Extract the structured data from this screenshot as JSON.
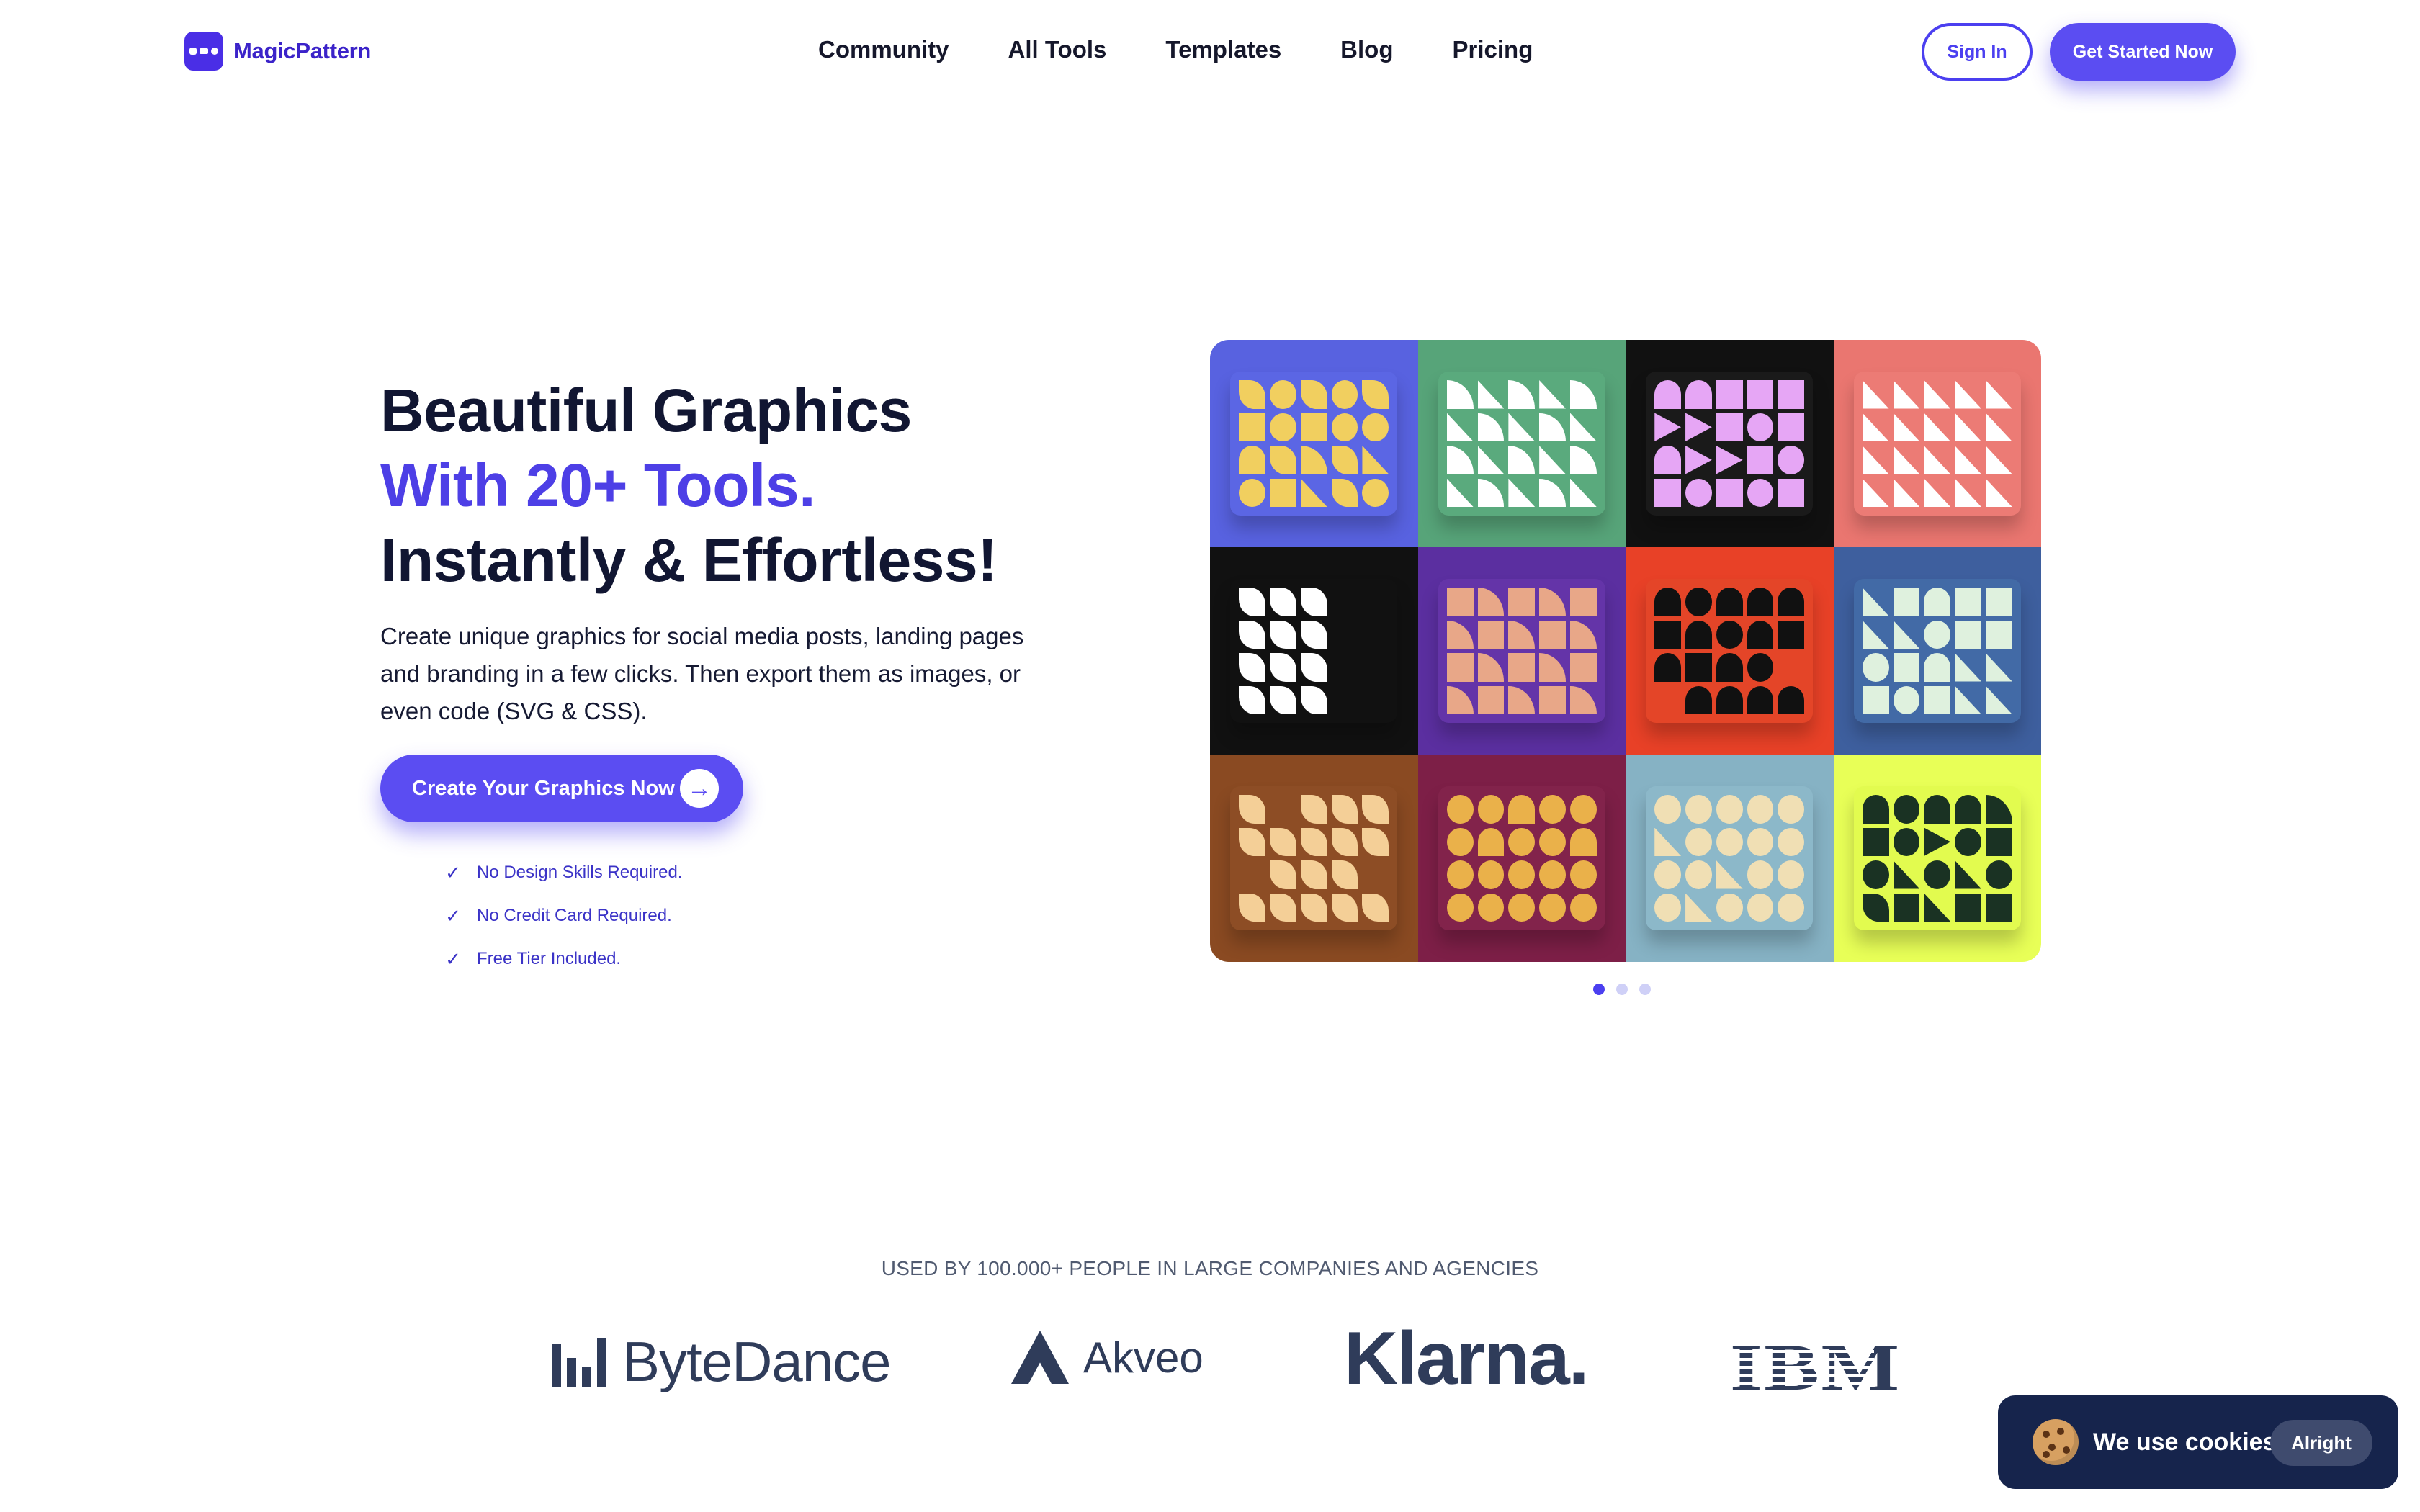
{
  "brand": {
    "name": "MagicPattern"
  },
  "nav": [
    "Community",
    "All Tools",
    "Templates",
    "Blog",
    "Pricing"
  ],
  "auth": {
    "signin": "Sign In",
    "get_started": "Get Started Now"
  },
  "hero": {
    "line1": "Beautiful Graphics",
    "line2": "With 20+ Tools.",
    "line3": "Instantly & Effortless!",
    "description": "Create unique graphics for social media posts, landing pages and branding in a few clicks. Then export them as images, or even code (SVG & CSS).",
    "cta": "Create Your Graphics Now",
    "features": [
      "No Design Skills Required.",
      "No Credit Card Required.",
      "Free Tier Included."
    ]
  },
  "carousel": {
    "slides": 3,
    "active": 1
  },
  "tiles": [
    {
      "bg": "#5862e0",
      "card": "#5b66e4",
      "fg": "#f1cf5f"
    },
    {
      "bg": "#57a479",
      "card": "#5aaa7d",
      "fg": "#ffffff"
    },
    {
      "bg": "#111111",
      "card": "#1a1a1a",
      "fg": "#e6a6f5"
    },
    {
      "bg": "#ea7670",
      "card": "#ec7b75",
      "fg": "#ffffff"
    },
    {
      "bg": "#111111",
      "card": "#111111",
      "fg": "#ffffff"
    },
    {
      "bg": "#5b2fa0",
      "card": "#6434a8",
      "fg": "#e8a788"
    },
    {
      "bg": "#e84127",
      "card": "#e44528",
      "fg": "#111111"
    },
    {
      "bg": "#3e5f9e",
      "card": "#426aa6",
      "fg": "#dff1de"
    },
    {
      "bg": "#8a4a22",
      "card": "#8d4d25",
      "fg": "#f4cf97"
    },
    {
      "bg": "#7d1f47",
      "card": "#82234b",
      "fg": "#eab14a"
    },
    {
      "bg": "#86b2c4",
      "card": "#8cb8c9",
      "fg": "#f0dfb4"
    },
    {
      "bg": "#e8ff57",
      "card": "#e2fb4f",
      "fg": "#1a3223"
    }
  ],
  "trusted": {
    "label": "USED BY 100.000+ PEOPLE IN LARGE COMPANIES AND AGENCIES",
    "logos": [
      "ByteDance",
      "Akveo",
      "Klarna.",
      "IBM"
    ]
  },
  "cookie": {
    "text": "We use cookies.",
    "button": "Alright"
  }
}
